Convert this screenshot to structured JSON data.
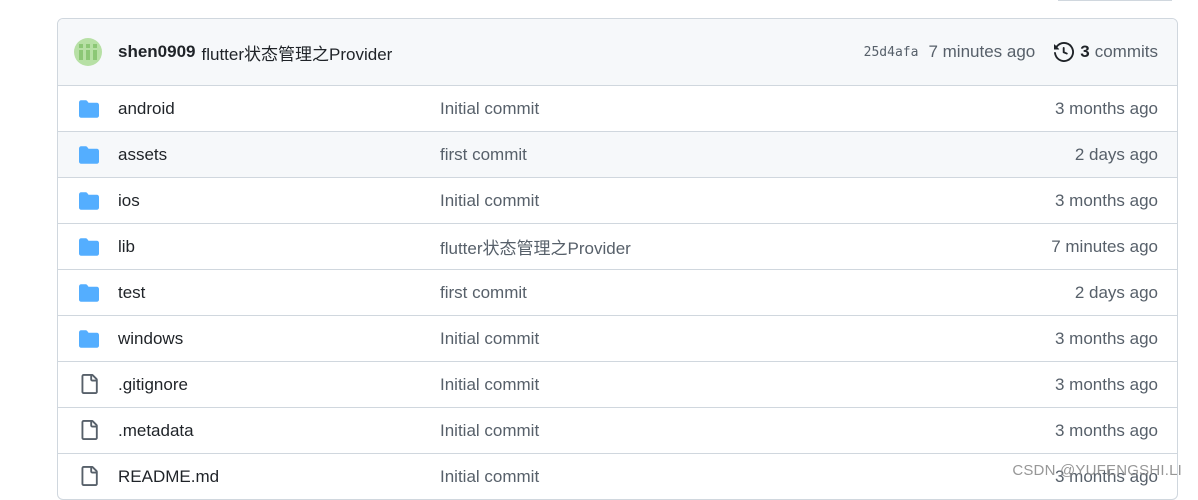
{
  "commit": {
    "author": "shen0909",
    "message": "flutter状态管理之Provider",
    "sha": "25d4afa",
    "time": "7 minutes ago",
    "count": "3",
    "count_label": "commits"
  },
  "files": [
    {
      "type": "folder",
      "name": "android",
      "commit": "Initial commit",
      "age": "3 months ago"
    },
    {
      "type": "folder",
      "name": "assets",
      "commit": "first commit",
      "age": "2 days ago"
    },
    {
      "type": "folder",
      "name": "ios",
      "commit": "Initial commit",
      "age": "3 months ago"
    },
    {
      "type": "folder",
      "name": "lib",
      "commit": "flutter状态管理之Provider",
      "age": "7 minutes ago"
    },
    {
      "type": "folder",
      "name": "test",
      "commit": "first commit",
      "age": "2 days ago"
    },
    {
      "type": "folder",
      "name": "windows",
      "commit": "Initial commit",
      "age": "3 months ago"
    },
    {
      "type": "file",
      "name": ".gitignore",
      "commit": "Initial commit",
      "age": "3 months ago"
    },
    {
      "type": "file",
      "name": ".metadata",
      "commit": "Initial commit",
      "age": "3 months ago"
    },
    {
      "type": "file",
      "name": "README.md",
      "commit": "Initial commit",
      "age": "3 months ago"
    }
  ],
  "watermark": "CSDN @YUFENGSHI.LI",
  "colors": {
    "folder": "#54aeff",
    "file": "#57606a",
    "avatar": "#b7e0a5",
    "border": "#d0d7de",
    "header_bg": "#f6f8fa"
  }
}
